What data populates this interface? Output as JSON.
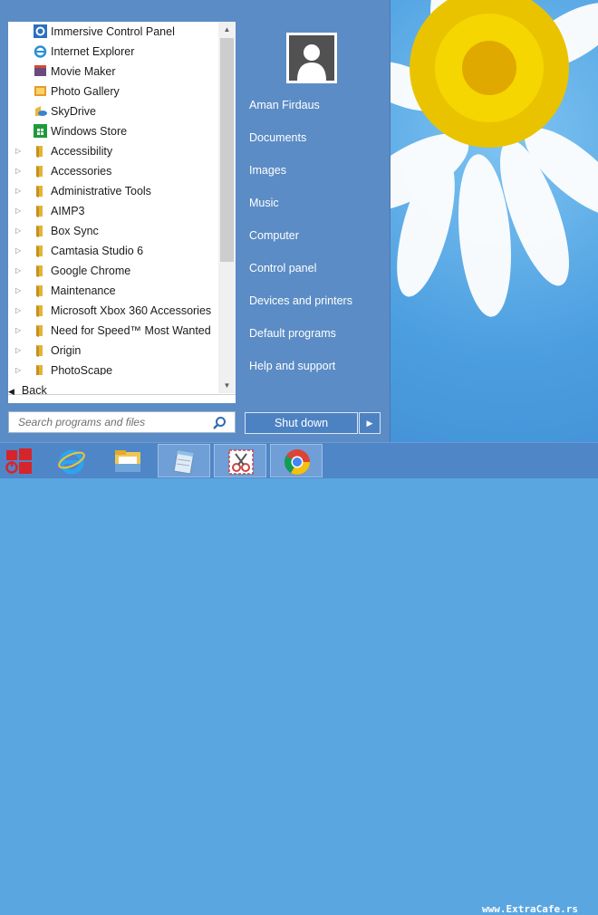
{
  "programs": {
    "items": [
      {
        "label": "Immersive Control Panel",
        "folder": false,
        "icon": "gear-icon"
      },
      {
        "label": "Internet Explorer",
        "folder": false,
        "icon": "ie-icon"
      },
      {
        "label": "Movie Maker",
        "folder": false,
        "icon": "movie-maker-icon"
      },
      {
        "label": "Photo Gallery",
        "folder": false,
        "icon": "photo-gallery-icon"
      },
      {
        "label": "SkyDrive",
        "folder": false,
        "icon": "skydrive-icon"
      },
      {
        "label": "Windows Store",
        "folder": false,
        "icon": "store-icon"
      },
      {
        "label": "Accessibility",
        "folder": true,
        "icon": "folder-icon"
      },
      {
        "label": "Accessories",
        "folder": true,
        "icon": "folder-icon"
      },
      {
        "label": "Administrative Tools",
        "folder": true,
        "icon": "folder-icon"
      },
      {
        "label": "AIMP3",
        "folder": true,
        "icon": "folder-icon"
      },
      {
        "label": "Box Sync",
        "folder": true,
        "icon": "folder-icon"
      },
      {
        "label": "Camtasia Studio 6",
        "folder": true,
        "icon": "folder-icon"
      },
      {
        "label": "Google Chrome",
        "folder": true,
        "icon": "folder-icon"
      },
      {
        "label": "Maintenance",
        "folder": true,
        "icon": "folder-icon"
      },
      {
        "label": "Microsoft Xbox 360 Accessories",
        "folder": true,
        "icon": "folder-icon"
      },
      {
        "label": "Need for Speed™ Most Wanted",
        "folder": true,
        "icon": "folder-icon"
      },
      {
        "label": "Origin",
        "folder": true,
        "icon": "folder-icon"
      },
      {
        "label": "PhotoScape",
        "folder": true,
        "icon": "folder-icon"
      }
    ],
    "back_label": "Back"
  },
  "search": {
    "placeholder": "Search programs and files"
  },
  "right_panel": {
    "user_name": "Aman Firdaus",
    "links": [
      "Documents",
      "Images",
      "Music",
      "Computer",
      "Control panel",
      "Devices and printers",
      "Default programs",
      "Help and support"
    ]
  },
  "shutdown": {
    "label": "Shut down"
  },
  "taskbar": {
    "items": [
      "start-icon",
      "ie-icon",
      "file-explorer-icon",
      "notepad-icon",
      "snipping-tool-icon",
      "chrome-icon"
    ]
  },
  "watermark": "www.ExtraCafe.rs",
  "colors": {
    "menu_bg": "#5b8cc5",
    "taskbar_bg": "#4f86c8",
    "list_bg": "#ffffff",
    "text_white": "#ffffff"
  }
}
